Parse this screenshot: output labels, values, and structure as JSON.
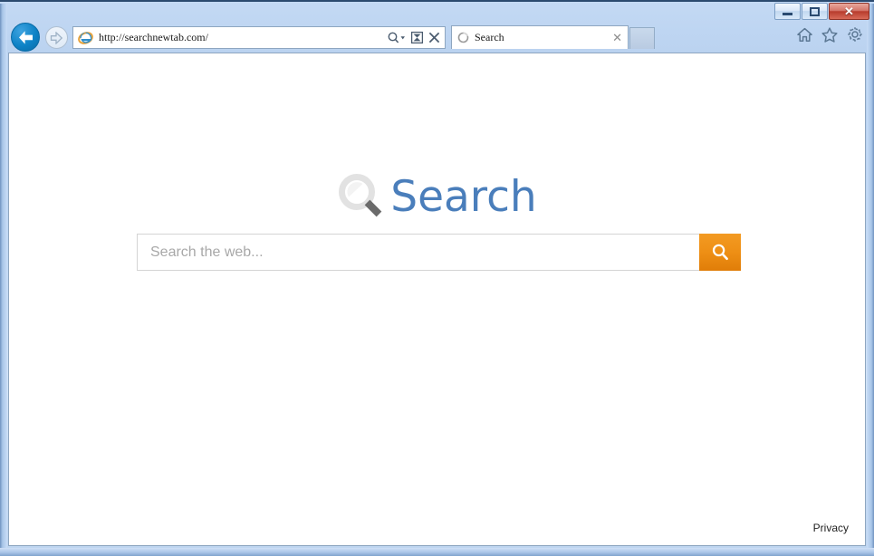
{
  "window": {
    "minimize_label": "",
    "restore_label": "",
    "close_label": "✕"
  },
  "browser": {
    "back_icon": "back-arrow-icon",
    "forward_icon": "forward-arrow-icon",
    "url": "http://searchnewtab.com/",
    "address_icons": [
      "search-dropdown-icon",
      "compatibility-view-icon",
      "stop-icon"
    ],
    "tab": {
      "label": "Search",
      "close_label": "✕",
      "favicon": "loading-spinner-icon"
    },
    "new_tab_label": "",
    "toolbar_icons": [
      "home-icon",
      "favorites-star-icon",
      "tools-gear-icon"
    ]
  },
  "page": {
    "logo": {
      "icon": "magnifier-icon",
      "text": "Search"
    },
    "search": {
      "placeholder": "Search the web...",
      "value": "",
      "submit_icon": "search-magnifier-icon"
    },
    "footer": {
      "privacy_label": "Privacy"
    },
    "colors": {
      "logo_blue": "#4a7ebb",
      "button_orange": "#ee8f15",
      "placeholder_gray": "#a8a8a8"
    }
  }
}
